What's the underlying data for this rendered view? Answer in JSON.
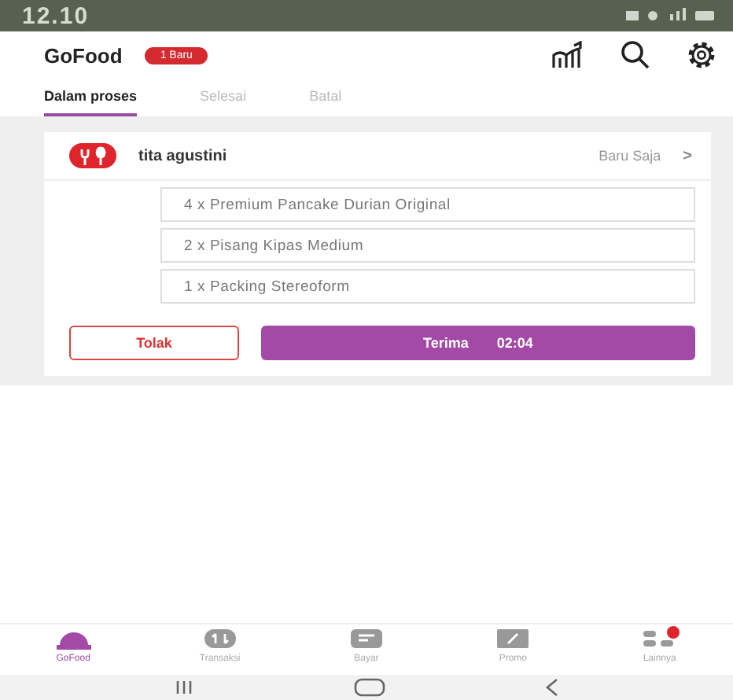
{
  "status_bar": {
    "time": "12.10"
  },
  "header": {
    "title": "GoFood",
    "badge": "1 Baru"
  },
  "tabs": [
    {
      "label": "Dalam proses",
      "selected": true
    },
    {
      "label": "Selesai",
      "selected": false
    },
    {
      "label": "Batal",
      "selected": false
    }
  ],
  "order": {
    "customer": "tita agustini",
    "time": "Baru Saja",
    "chevron": ">",
    "items": [
      "4 x Premium Pancake Durian Original",
      "2 x Pisang Kipas Medium",
      "1 x Packing Stereoform"
    ],
    "reject_button": "Tolak",
    "accept_button": "Terima",
    "countdown": "02:04"
  },
  "bottom_nav": [
    {
      "label": "GoFood",
      "kind": "food",
      "selected": true,
      "dot": false
    },
    {
      "label": "Transaksi",
      "kind": "transfer",
      "selected": false,
      "dot": false
    },
    {
      "label": "Bayar",
      "kind": "pay",
      "selected": false,
      "dot": false
    },
    {
      "label": "Promo",
      "kind": "promo",
      "selected": false,
      "dot": false
    },
    {
      "label": "Lainnya",
      "kind": "more",
      "selected": false,
      "dot": true
    }
  ]
}
